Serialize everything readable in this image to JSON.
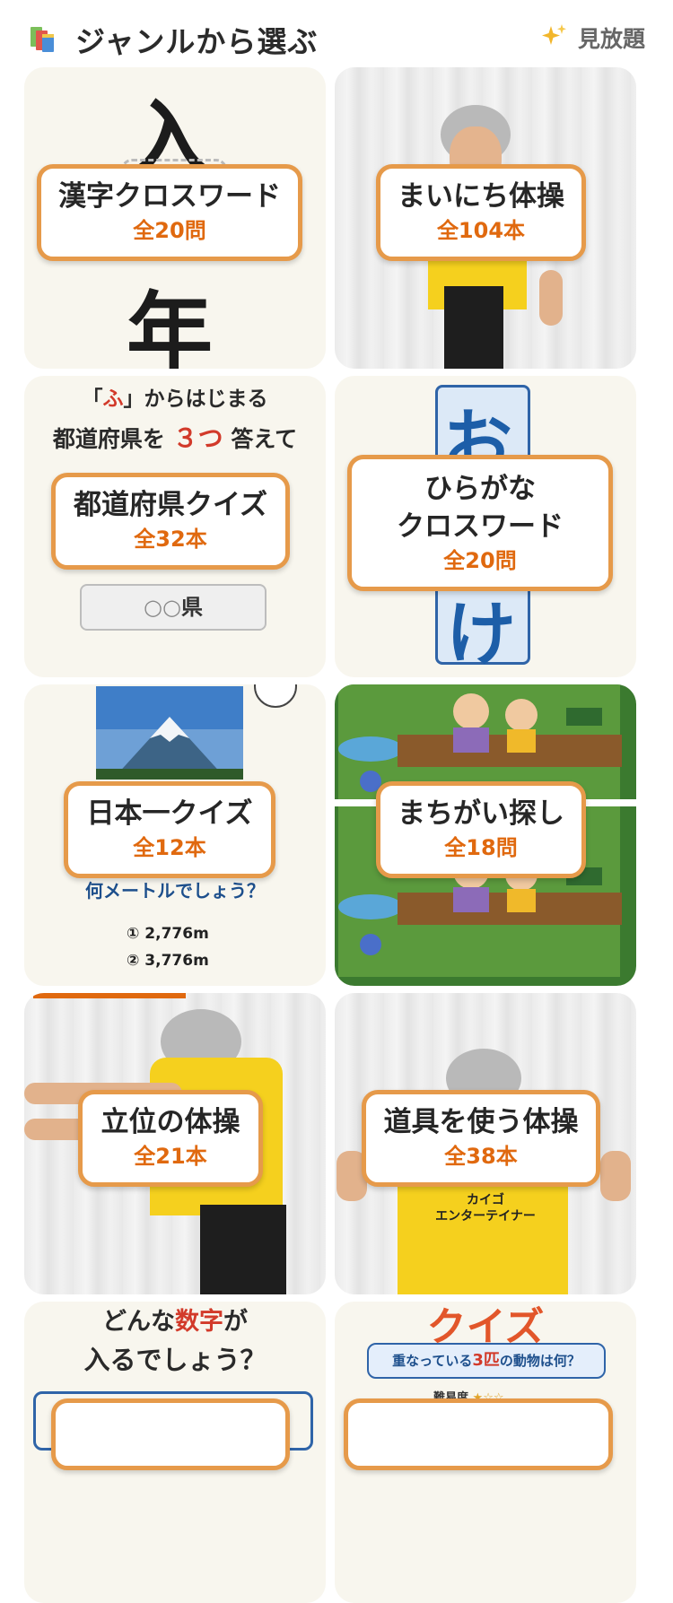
{
  "header": {
    "title": "ジャンルから選ぶ",
    "books_icon": "books-icon",
    "sparkle_icon": "sparkles-icon",
    "unlimited_label": "見放題"
  },
  "colors": {
    "label_border": "#e69a4a",
    "count_text": "#e0690f",
    "card_cream": "#f8f6ee"
  },
  "tiles": [
    {
      "name": "漢字クロスワード",
      "count": "全20問",
      "art": {
        "char_top": "入",
        "char_bottom": "年"
      }
    },
    {
      "name": "まいにち体操",
      "count": "全104本"
    },
    {
      "name": "都道府県クイズ",
      "count": "全32本",
      "art": {
        "line1_open": "「",
        "line1_kana": "ふ",
        "line1_close": "」からはじまる",
        "line2_pre": "都道府県を",
        "line2_num": "３つ",
        "line2_post": "答えて",
        "answer_circles": "○○",
        "answer_suffix": "県"
      }
    },
    {
      "name_line1": "ひらがな",
      "name_line2": "クロスワード",
      "count": "全20問",
      "art": {
        "char_top": "お",
        "char_bottom": "け"
      }
    },
    {
      "name": "日本一クイズ",
      "count": "全12本",
      "art": {
        "question": "何メートルでしょう？",
        "option1": "① 2,776m",
        "option2": "② 3,776m"
      }
    },
    {
      "name": "まちがい探し",
      "count": "全18問"
    },
    {
      "name": "立位の体操",
      "count": "全21本"
    },
    {
      "name": "道具を使う体操",
      "count": "全38本",
      "art": {
        "shirt_text_1": "カイゴ",
        "shirt_text_2": "エンターテイナー"
      }
    },
    {
      "art": {
        "line1": "どんな",
        "line1_red": "数字",
        "line1_end": "が",
        "line2": "入るでしょう？"
      }
    },
    {
      "art": {
        "title": "クイズ",
        "question_pre": "重なっている",
        "question_red": "3匹",
        "question_post": "の動物は何？",
        "difficulty": "難易度",
        "stars": "★☆☆"
      }
    }
  ]
}
